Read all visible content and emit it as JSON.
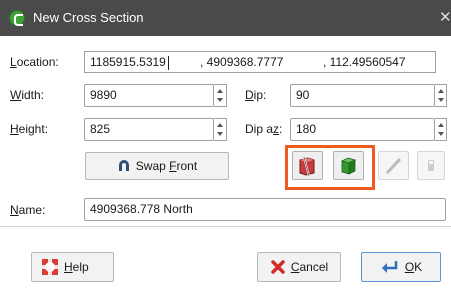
{
  "window": {
    "title": "New Cross Section"
  },
  "location": {
    "label": "Location:",
    "x": "1185915.5319",
    "y": ", 4909368.7777",
    "z": ", 112.49560547"
  },
  "width": {
    "label": "Width:",
    "value": "9890"
  },
  "height": {
    "label": "Height:",
    "value": "825"
  },
  "dip": {
    "label": "Dip:",
    "value": "90"
  },
  "dip_az": {
    "label": "Dip az:",
    "value": "180"
  },
  "swap_front": {
    "label": "Swap Front"
  },
  "name": {
    "label": "Name:",
    "value": "4909368.778 North"
  },
  "buttons": {
    "help": "Help",
    "cancel": "Cancel",
    "ok": "OK"
  },
  "colors": {
    "highlight": "#f05a22",
    "titlebar": "#4a4a4a"
  }
}
